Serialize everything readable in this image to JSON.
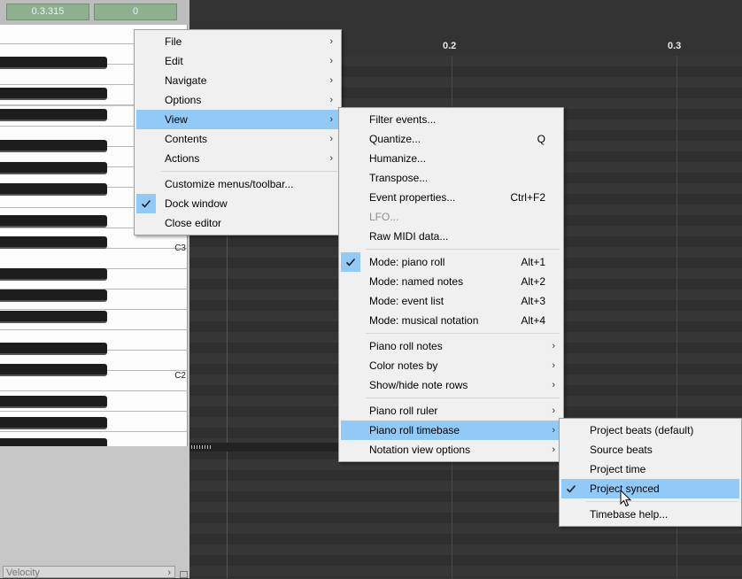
{
  "top_fields": {
    "position": "0.3.315",
    "value": "0"
  },
  "piano": {
    "labels": [
      "C3",
      "C2"
    ]
  },
  "velocity": {
    "label": "Velocity"
  },
  "ruler": {
    "labels": [
      "0.2",
      "0.3"
    ]
  },
  "main_menu": {
    "items": [
      {
        "label": "File",
        "submenu": true
      },
      {
        "label": "Edit",
        "submenu": true
      },
      {
        "label": "Navigate",
        "submenu": true
      },
      {
        "label": "Options",
        "submenu": true
      },
      {
        "label": "View",
        "submenu": true,
        "highlighted": true
      },
      {
        "label": "Contents",
        "submenu": true
      },
      {
        "label": "Actions",
        "submenu": true
      },
      {
        "separator": true
      },
      {
        "label": "Customize menus/toolbar..."
      },
      {
        "label": "Dock window",
        "checked": true
      },
      {
        "label": "Close editor"
      }
    ]
  },
  "view_menu": {
    "items": [
      {
        "label": "Filter events..."
      },
      {
        "label": "Quantize...",
        "shortcut": "Q"
      },
      {
        "label": "Humanize..."
      },
      {
        "label": "Transpose..."
      },
      {
        "label": "Event properties...",
        "shortcut": "Ctrl+F2"
      },
      {
        "label": "LFO...",
        "disabled": true
      },
      {
        "label": "Raw MIDI data..."
      },
      {
        "separator": true
      },
      {
        "label": "Mode: piano roll",
        "shortcut": "Alt+1",
        "checked": true
      },
      {
        "label": "Mode: named notes",
        "shortcut": "Alt+2"
      },
      {
        "label": "Mode: event list",
        "shortcut": "Alt+3"
      },
      {
        "label": "Mode: musical notation",
        "shortcut": "Alt+4"
      },
      {
        "separator": true
      },
      {
        "label": "Piano roll notes",
        "submenu": true
      },
      {
        "label": "Color notes by",
        "submenu": true
      },
      {
        "label": "Show/hide note rows",
        "submenu": true
      },
      {
        "separator": true
      },
      {
        "label": "Piano roll ruler",
        "submenu": true
      },
      {
        "label": "Piano roll timebase",
        "submenu": true,
        "highlighted": true
      },
      {
        "label": "Notation view options",
        "submenu": true
      }
    ]
  },
  "timebase_menu": {
    "items": [
      {
        "label": "Project beats (default)"
      },
      {
        "label": "Source beats"
      },
      {
        "label": "Project time"
      },
      {
        "label": "Project synced",
        "checked": true,
        "highlighted": true
      },
      {
        "separator": true
      },
      {
        "label": "Timebase help..."
      }
    ]
  },
  "colors": {
    "highlight": "#91c9f7",
    "menu_bg": "#f0f0f0",
    "editor_bg": "#2e2e2e"
  }
}
